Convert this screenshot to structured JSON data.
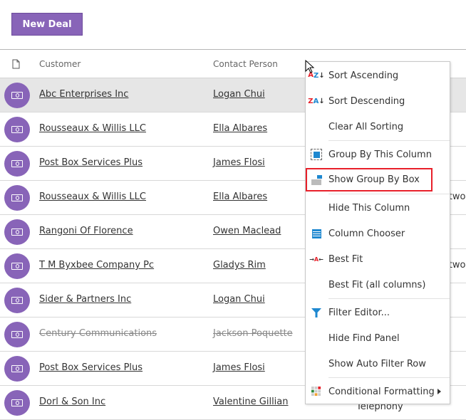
{
  "toolbar": {
    "new_deal_label": "New Deal"
  },
  "grid": {
    "columns": [
      "Customer",
      "Contact Person"
    ],
    "rows": [
      {
        "customer": "Abc Enterprises Inc",
        "contact": "Logan Chui",
        "selected": true
      },
      {
        "customer": "Rousseaux & Willis LLC",
        "contact": "Ella Albares"
      },
      {
        "customer": "Post Box Services Plus",
        "contact": "James Flosi"
      },
      {
        "customer": "Rousseaux & Willis LLC",
        "contact": "Ella Albares",
        "extra": "Network"
      },
      {
        "customer": "Rangoni Of Florence",
        "contact": "Owen Maclead"
      },
      {
        "customer": "T M Byxbee Company Pc",
        "contact": "Gladys Rim",
        "extra": "Network"
      },
      {
        "customer": "Sider & Partners Inc",
        "contact": "Logan Chui"
      },
      {
        "customer": "Century Communications",
        "contact": "Jackson Poquette",
        "strikethrough": true
      },
      {
        "customer": "Post Box Services Plus",
        "contact": "James Flosi"
      },
      {
        "customer": "Dorl & Son Inc",
        "contact": "Valentine Gillian",
        "extra": "Telephony"
      }
    ]
  },
  "context_menu": {
    "items": [
      {
        "label": "Sort Ascending",
        "icon": "sort-ascending-icon"
      },
      {
        "label": "Sort Descending",
        "icon": "sort-descending-icon"
      },
      {
        "label": "Clear All Sorting",
        "icon": ""
      },
      {
        "label": "Group By This Column",
        "icon": "group-by-column-icon"
      },
      {
        "label": "Show Group By Box",
        "icon": "group-by-box-icon",
        "highlighted": true
      },
      {
        "label": "Hide This Column",
        "icon": ""
      },
      {
        "label": "Column Chooser",
        "icon": "column-chooser-icon"
      },
      {
        "label": "Best Fit",
        "icon": "best-fit-icon"
      },
      {
        "label": "Best Fit (all columns)",
        "icon": ""
      },
      {
        "label": "Filter Editor...",
        "icon": "filter-icon"
      },
      {
        "label": "Hide Find Panel",
        "icon": ""
      },
      {
        "label": "Show Auto Filter Row",
        "icon": ""
      },
      {
        "label": "Conditional Formatting",
        "icon": "conditional-formatting-icon",
        "submenu": true
      }
    ]
  },
  "colors": {
    "accent": "#8864b8",
    "highlight_border": "#e8202a",
    "icon_blue": "#1e88d0"
  }
}
